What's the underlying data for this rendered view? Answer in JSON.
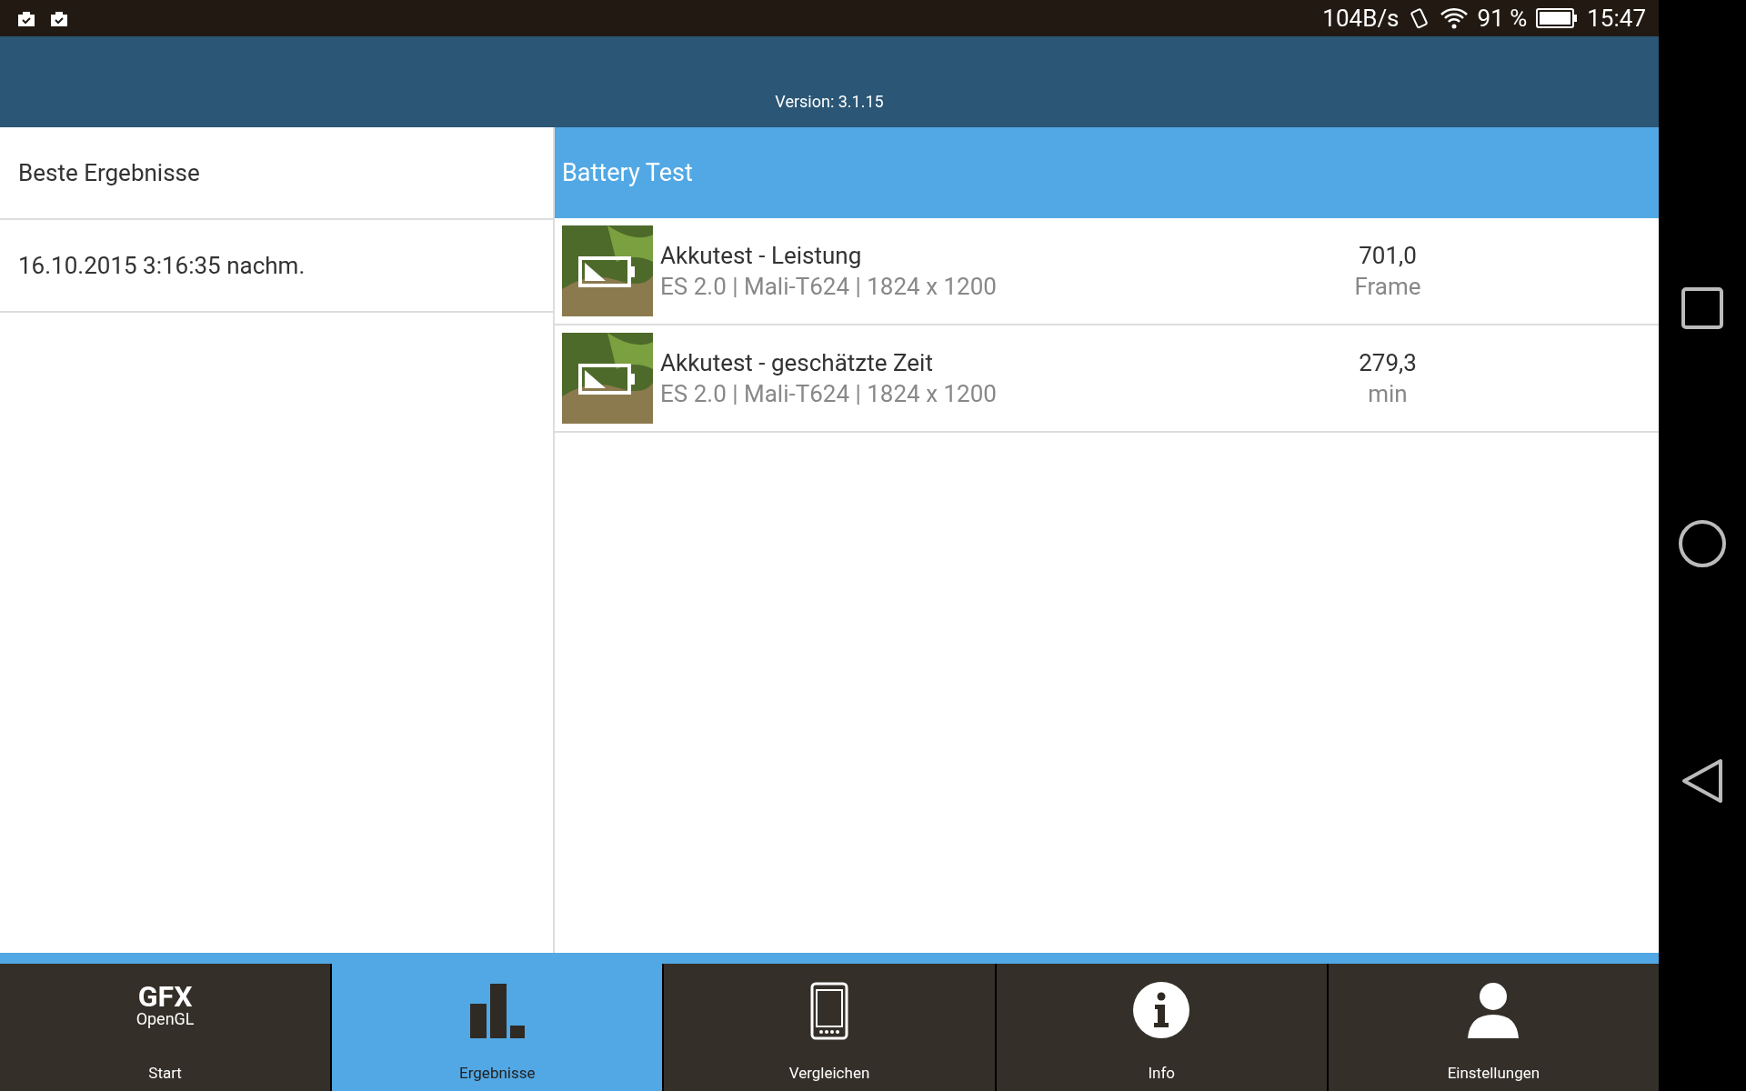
{
  "status_bar": {
    "speed": "104B/s",
    "battery_percent": "91 %",
    "time": "15:47"
  },
  "header": {
    "version": "Version: 3.1.15"
  },
  "left_panel": {
    "title": "Beste Ergebnisse",
    "items": [
      {
        "label": "16.10.2015 3:16:35 nachm.",
        "selected": false
      }
    ]
  },
  "right_panel": {
    "title": "Battery Test",
    "rows": [
      {
        "name": "Akkutest - Leistung",
        "details": "ES 2.0 | Mali-T624 | 1824 x 1200",
        "value": "701,0",
        "unit": "Frame"
      },
      {
        "name": "Akkutest - geschätzte Zeit",
        "details": "ES 2.0 | Mali-T624 | 1824 x 1200",
        "value": "279,3",
        "unit": "min"
      }
    ]
  },
  "bottom_nav": [
    {
      "kind": "logo",
      "logo_title": "GFX",
      "logo_subtitle": "OpenGL",
      "label": "Start",
      "selected": false
    },
    {
      "kind": "chart",
      "label": "Ergebnisse",
      "selected": true
    },
    {
      "kind": "phone",
      "label": "Vergleichen",
      "selected": false
    },
    {
      "kind": "info",
      "label": "Info",
      "selected": false
    },
    {
      "kind": "person",
      "label": "Einstellungen",
      "selected": false
    }
  ]
}
